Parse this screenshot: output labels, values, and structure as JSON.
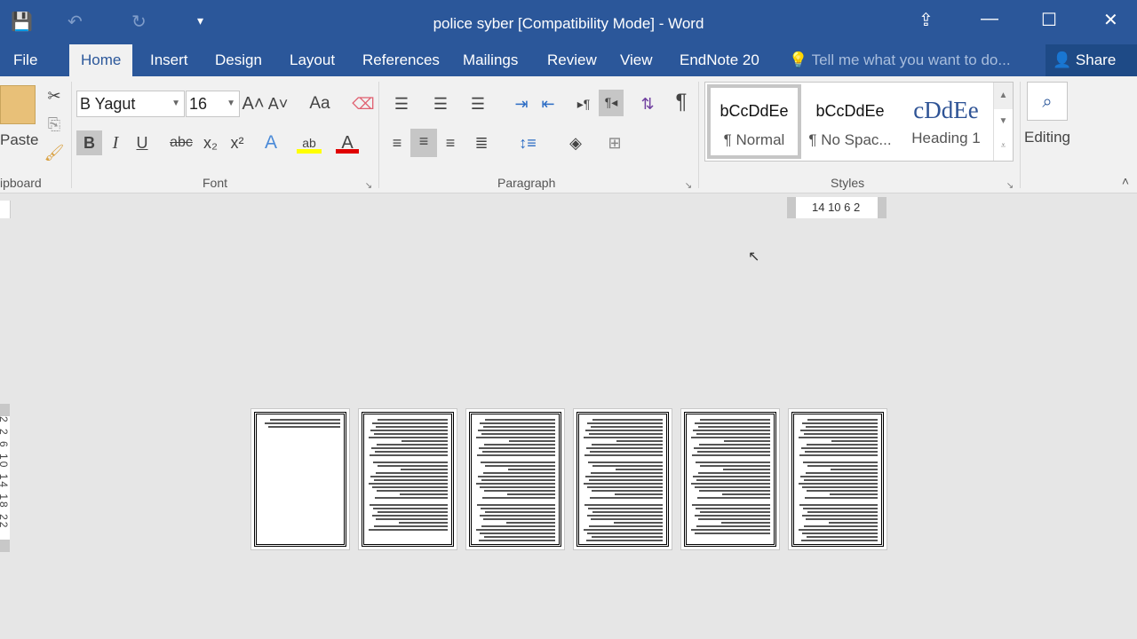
{
  "window": {
    "title": "police syber [Compatibility Mode] - Word"
  },
  "quick_access": {
    "save": "💾",
    "undo": "↶",
    "redo": "↻",
    "customize": "▾"
  },
  "window_controls": {
    "ribbon_display": "⇪",
    "minimize": "—",
    "maximize": "☐",
    "close": "✕"
  },
  "tabs": [
    {
      "label": "File"
    },
    {
      "label": "Home",
      "active": true
    },
    {
      "label": "Insert"
    },
    {
      "label": "Design"
    },
    {
      "label": "Layout"
    },
    {
      "label": "References"
    },
    {
      "label": "Mailings"
    },
    {
      "label": "Review"
    },
    {
      "label": "View"
    },
    {
      "label": "EndNote 20"
    }
  ],
  "tell_me": {
    "placeholder": "Tell me what you want to do..."
  },
  "share": {
    "label": "Share"
  },
  "clipboard": {
    "paste": "Paste",
    "group": "ipboard"
  },
  "font": {
    "name": "B Yagut",
    "size": "16",
    "group": "Font",
    "bold": "B",
    "italic": "I",
    "underline": "U",
    "strike": "abc",
    "sub": "x₂",
    "sup": "x²",
    "grow": "A˄",
    "shrink": "A˅",
    "case": "Aa",
    "highlight_color": "#ffff00",
    "font_color": "#e00000"
  },
  "paragraph": {
    "group": "Paragraph",
    "pilcrow": "¶"
  },
  "styles": {
    "group": "Styles",
    "items": [
      {
        "sample": "bCcDdEe",
        "name": "¶ Normal",
        "selected": true
      },
      {
        "sample": "bCcDdEe",
        "name": "¶ No Spac..."
      },
      {
        "sample": "cDdEe",
        "name": "Heading 1"
      }
    ]
  },
  "editing": {
    "label": "Editing"
  },
  "ruler": {
    "h": "14 10 6 2",
    "v": "2 2 6 10 14 18 22"
  },
  "pages": [
    1,
    2,
    3,
    4,
    5,
    6
  ]
}
